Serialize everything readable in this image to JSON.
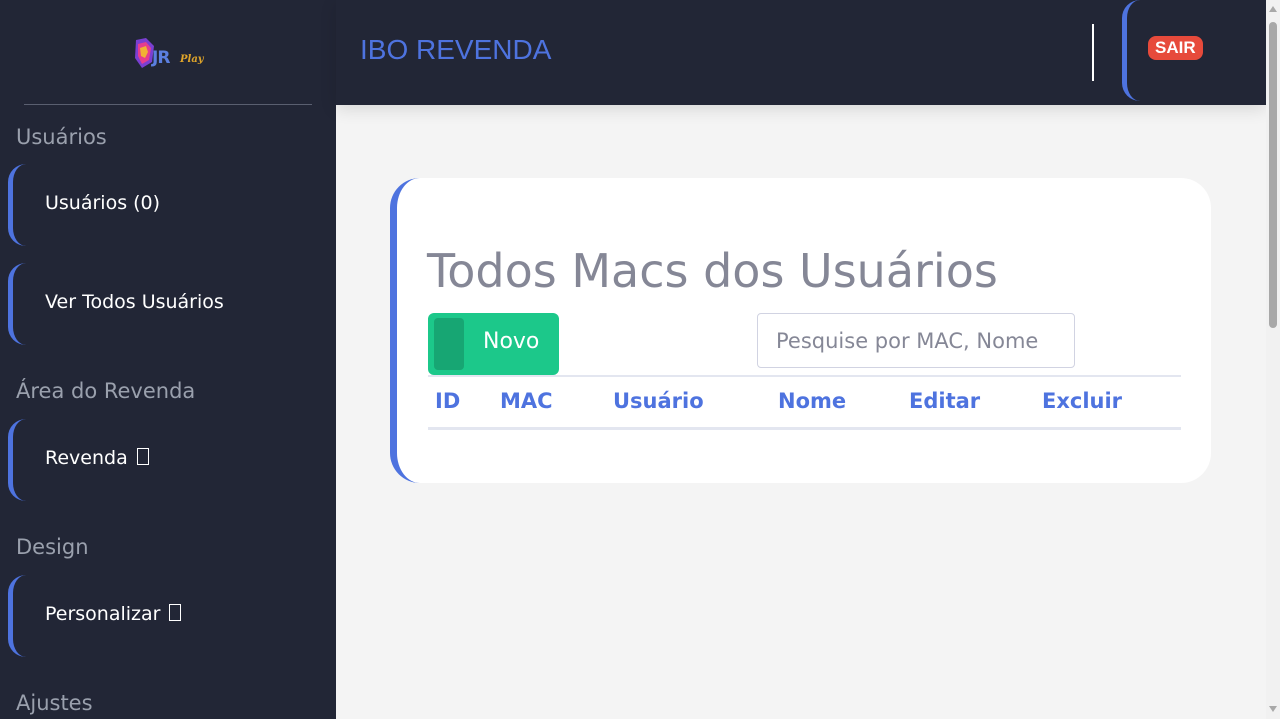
{
  "colors": {
    "accent": "#4e73df",
    "success": "#1cc88a",
    "danger": "#e74a3b",
    "sidebar_bg": "#222636"
  },
  "logo": {
    "text": "JR",
    "subtext": "Play",
    "icon": "jr-play-logo"
  },
  "header": {
    "brand": "IBO REVENDA",
    "logout_label": "SAIR"
  },
  "sidebar": {
    "sections": [
      {
        "title": "Usuários"
      },
      {
        "title": "Área do Revenda"
      },
      {
        "title": "Design"
      },
      {
        "title": "Ajustes"
      }
    ],
    "items": [
      {
        "label": "Usuários (0)"
      },
      {
        "label": "Ver Todos Usuários"
      },
      {
        "label": "Revenda",
        "icon": "unknown-glyph-icon"
      },
      {
        "label": "Personalizar",
        "icon": "unknown-glyph-icon"
      }
    ]
  },
  "main": {
    "title": "Todos Macs dos Usuários",
    "new_button": "Novo",
    "search_placeholder": "Pesquise por MAC, Nome",
    "columns": [
      "ID",
      "MAC",
      "Usuário",
      "Nome",
      "Editar",
      "Excluir"
    ]
  }
}
